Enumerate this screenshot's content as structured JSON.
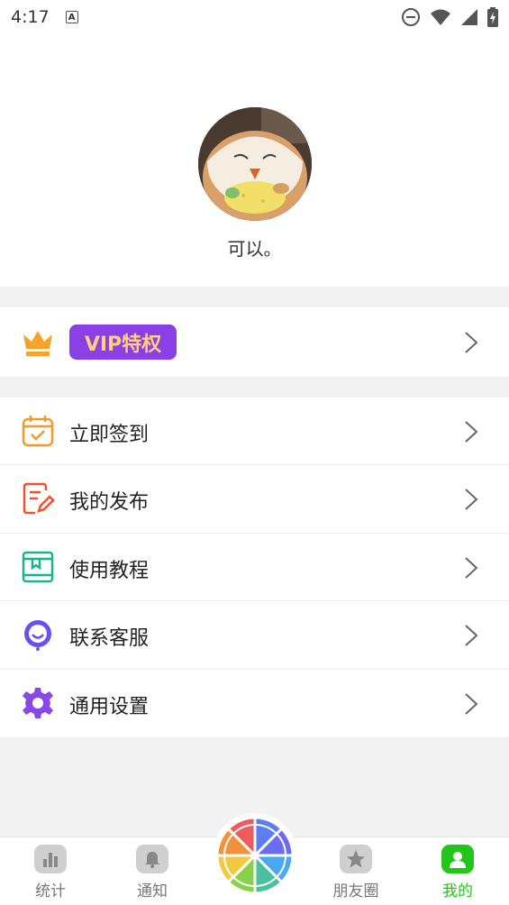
{
  "status_bar": {
    "time": "4:17",
    "notif_letter": "A"
  },
  "profile": {
    "nickname": "可以。"
  },
  "vip": {
    "label": "VIP特权"
  },
  "menu": [
    {
      "label": "立即签到",
      "icon": "calendar-check-icon",
      "color": "#f39a2b"
    },
    {
      "label": "我的发布",
      "icon": "edit-document-icon",
      "color": "#f0522e"
    },
    {
      "label": "使用教程",
      "icon": "book-icon",
      "color": "#17b58a"
    },
    {
      "label": "联系客服",
      "icon": "headset-smile-icon",
      "color": "#6b4ff0"
    },
    {
      "label": "通用设置",
      "icon": "gear-icon",
      "color": "#8a49e6"
    }
  ],
  "tabs": [
    {
      "label": "统计",
      "icon": "bar-chart-icon"
    },
    {
      "label": "通知",
      "icon": "bell-icon"
    },
    {
      "label": "朋友圈",
      "icon": "star-icon"
    },
    {
      "label": "我的",
      "icon": "user-icon",
      "active": true
    }
  ],
  "colors": {
    "accent": "#22c51a",
    "vip_bg": "#8b3fe6",
    "vip_text": "#ffd07a",
    "crown": "#f5a32b"
  }
}
